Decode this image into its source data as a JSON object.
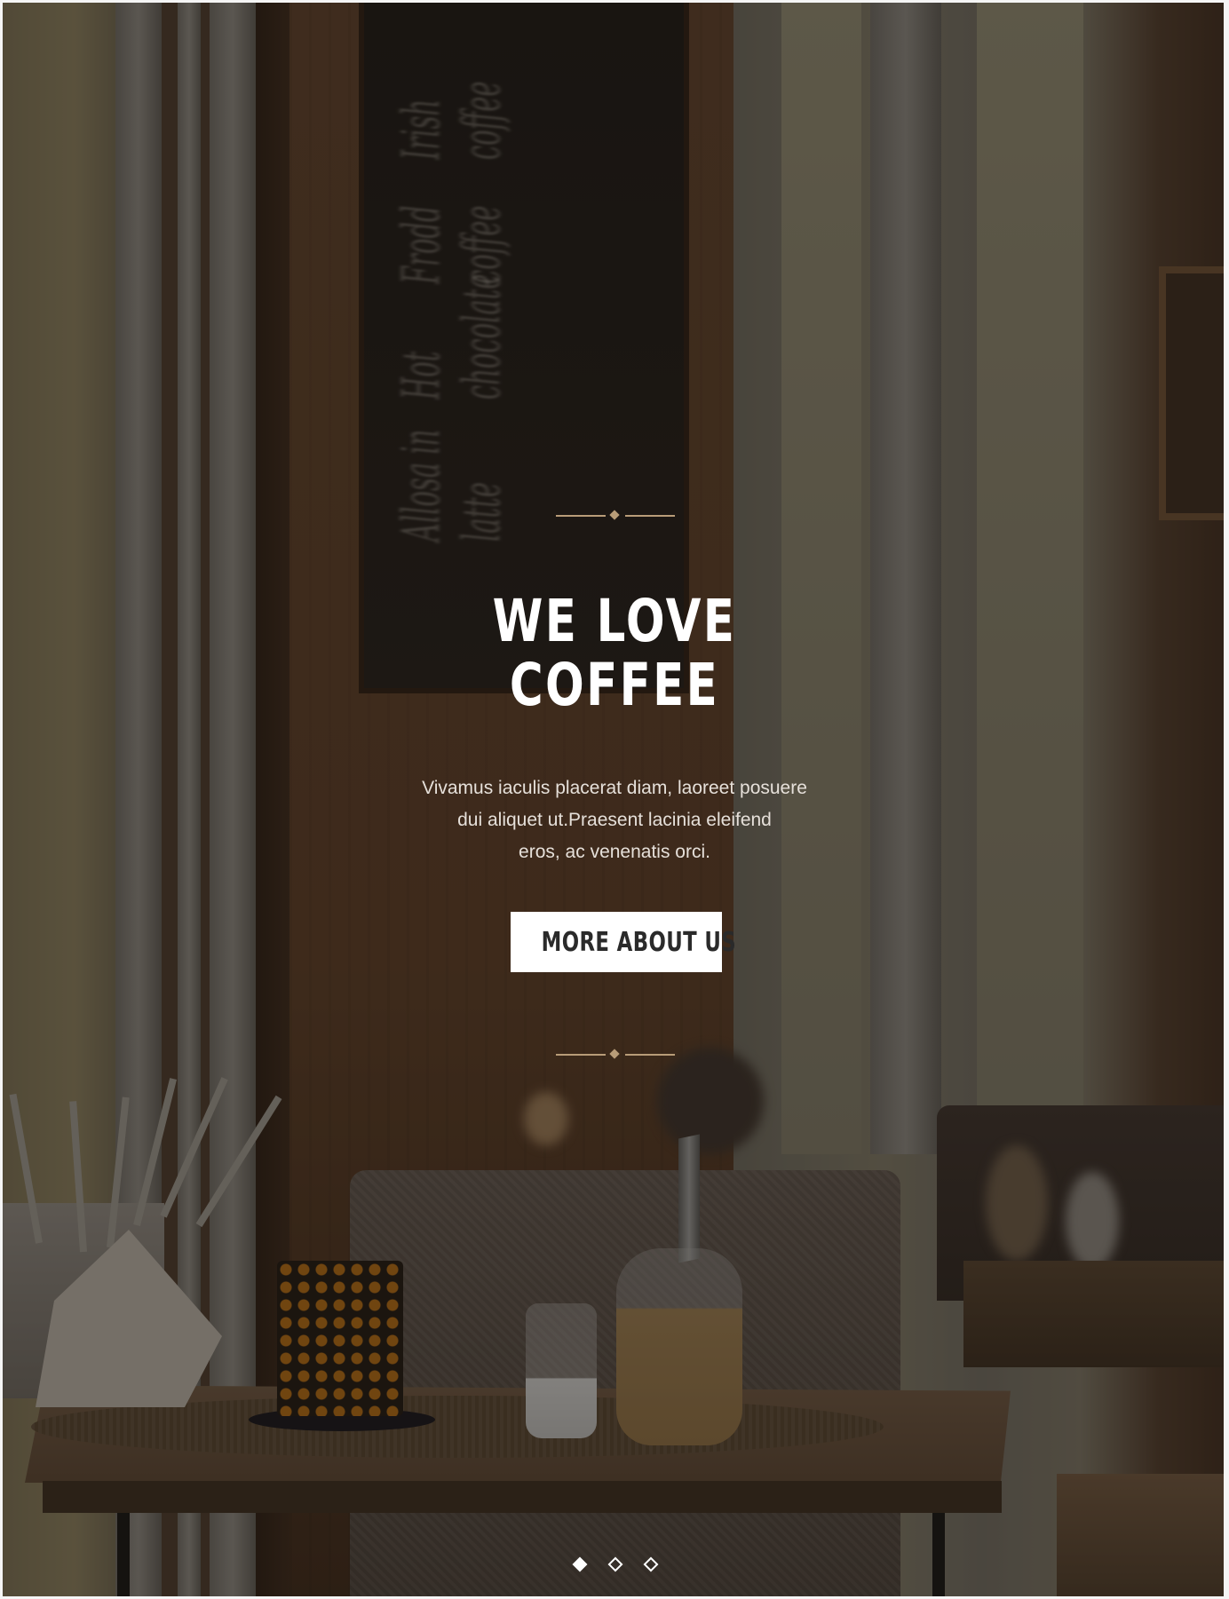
{
  "hero": {
    "heading_line1": "WE LOVE",
    "heading_line2": "COFFEE",
    "description_line1": "Vivamus iaculis placerat diam, laoreet posuere",
    "description_line2": "dui aliquet ut.Praesent lacinia eleifend",
    "description_line3": "eros, ac venenatis orci.",
    "button_label": "MORE ABOUT US"
  },
  "slider": {
    "slide_count": 3,
    "active_index": 0
  },
  "colors": {
    "accent": "#b89c78",
    "button_bg": "#ffffff",
    "button_text": "#2a2a2a",
    "heading": "#ffffff"
  },
  "icons": {
    "ornament": "diamond-divider-icon",
    "slide_dot": "diamond-icon"
  }
}
